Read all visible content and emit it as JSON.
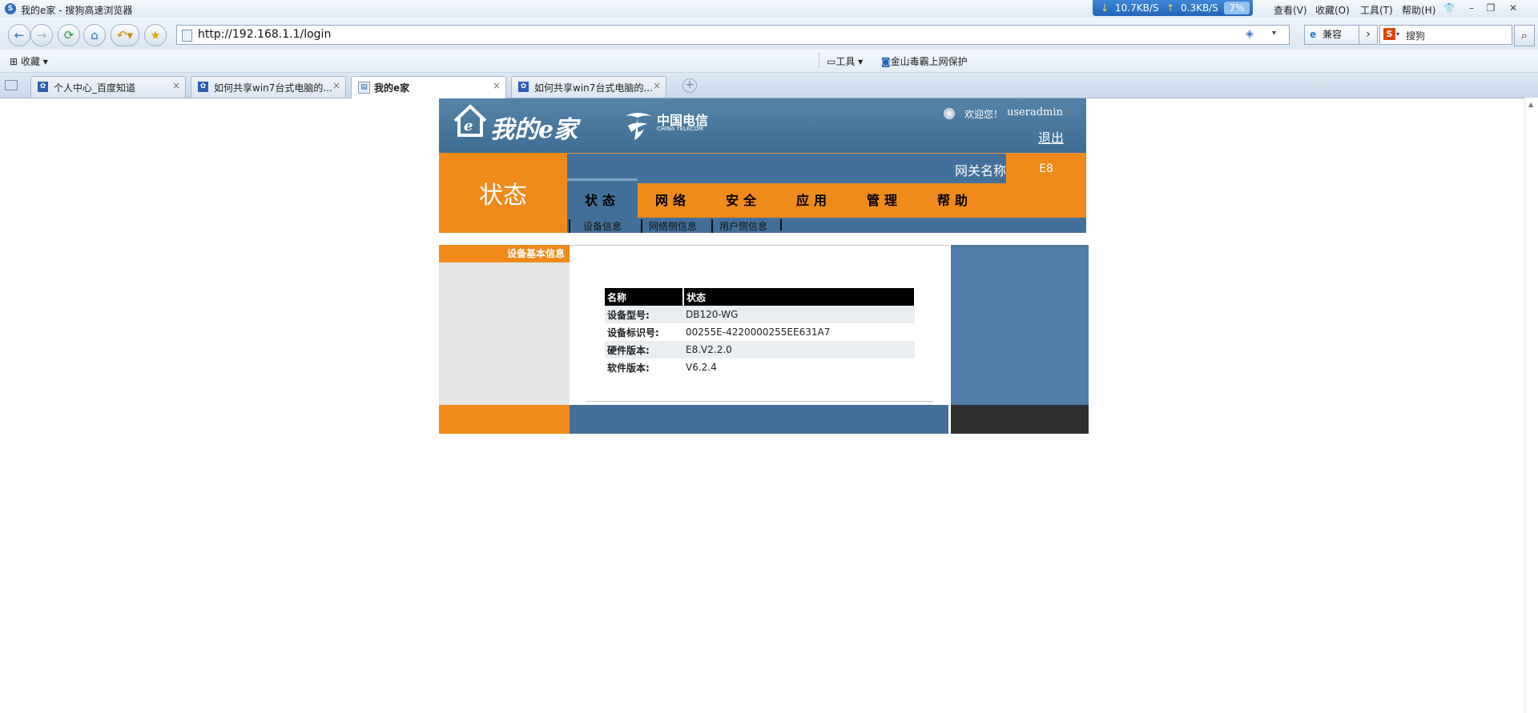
{
  "browser": {
    "window_title": "我的e家 - 搜狗高速浏览器",
    "net_speed": {
      "down": "10.7KB/S",
      "up": "0.3KB/S",
      "cpu": "7%"
    },
    "title_menu": [
      "查看(V)",
      "收藏(O)",
      "工具(T)",
      "帮助(H)"
    ],
    "address": "http://192.168.1.1/login",
    "compat_label": "兼容",
    "search_placeholder": "搜狗",
    "favorites_label": "收藏",
    "tools_label": "工具",
    "kingsoft_label": "金山毒霸上网保护",
    "tabs": [
      {
        "label": "个人中心_百度知道"
      },
      {
        "label": "如何共享win7台式电脑的..."
      },
      {
        "label": "我的e家"
      },
      {
        "label": "如何共享win7台式电脑的..."
      }
    ]
  },
  "router": {
    "brand": "我的e家",
    "telecom_cn": "中国电信",
    "telecom_en": "CHINA TELECOM",
    "welcome": "欢迎您！",
    "username": "useradmin",
    "logout": "退出",
    "section_big": "状态",
    "gateway_label": "网关名称",
    "gateway_value": "E8",
    "menu": [
      "状态",
      "网络",
      "安全",
      "应用",
      "管理",
      "帮助"
    ],
    "submenu": [
      "设备信息",
      "网络侧信息",
      "用户侧信息"
    ],
    "sidebar_section": "设备基本信息",
    "table": {
      "headers": [
        "名称",
        "状态"
      ],
      "rows": [
        {
          "key": "设备型号:",
          "value": "DB120-WG"
        },
        {
          "key": "设备标识号:",
          "value": "00255E-4220000255EE631A7"
        },
        {
          "key": "硬件版本:",
          "value": "E8.V2.2.0"
        },
        {
          "key": "软件版本:",
          "value": "V6.2.4"
        }
      ]
    }
  },
  "colors": {
    "orange": "#f08a1a",
    "blue": "#43709a",
    "dark": "#2f2f2f"
  }
}
